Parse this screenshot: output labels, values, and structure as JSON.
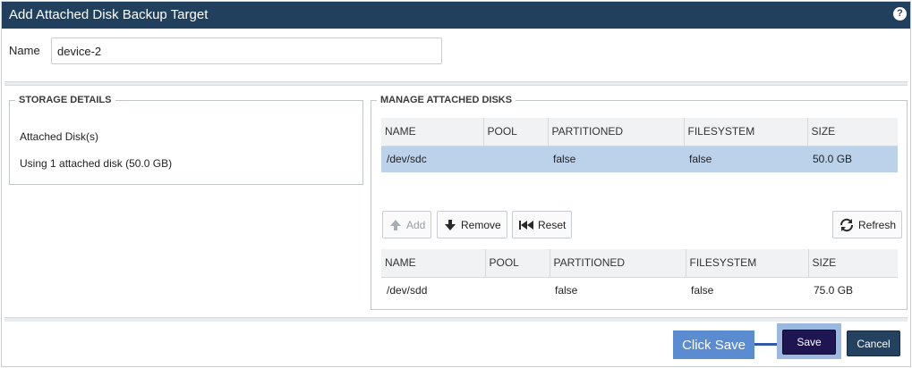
{
  "dialog": {
    "title": "Add Attached Disk Backup Target",
    "help_icon": "question-circle-icon"
  },
  "name_field": {
    "label": "Name",
    "value": "device-2"
  },
  "storage_details": {
    "legend": "STORAGE DETAILS",
    "line1": "Attached Disk(s)",
    "line2": "Using 1 attached disk (50.0 GB)"
  },
  "manage": {
    "legend": "MANAGE ATTACHED DISKS",
    "attached": {
      "columns": [
        "NAME",
        "POOL",
        "PARTITIONED",
        "FILESYSTEM",
        "SIZE"
      ],
      "rows": [
        {
          "name": "/dev/sdc",
          "pool": "",
          "partitioned": "false",
          "filesystem": "false",
          "size": "50.0 GB",
          "selected": true
        }
      ]
    },
    "toolbar": {
      "add": "Add",
      "remove": "Remove",
      "reset": "Reset",
      "refresh": "Refresh"
    },
    "available": {
      "columns": [
        "NAME",
        "POOL",
        "PARTITIONED",
        "FILESYSTEM",
        "SIZE"
      ],
      "rows": [
        {
          "name": "/dev/sdd",
          "pool": "",
          "partitioned": "false",
          "filesystem": "false",
          "size": "75.0 GB"
        }
      ]
    }
  },
  "footer": {
    "callout": "Click Save",
    "save": "Save",
    "cancel": "Cancel"
  },
  "colors": {
    "titlebar": "#21405e",
    "selected_row": "#bcd2ea",
    "callout": "#5b8bd0",
    "save_button": "#1e1552",
    "cancel_button": "#24415f"
  }
}
